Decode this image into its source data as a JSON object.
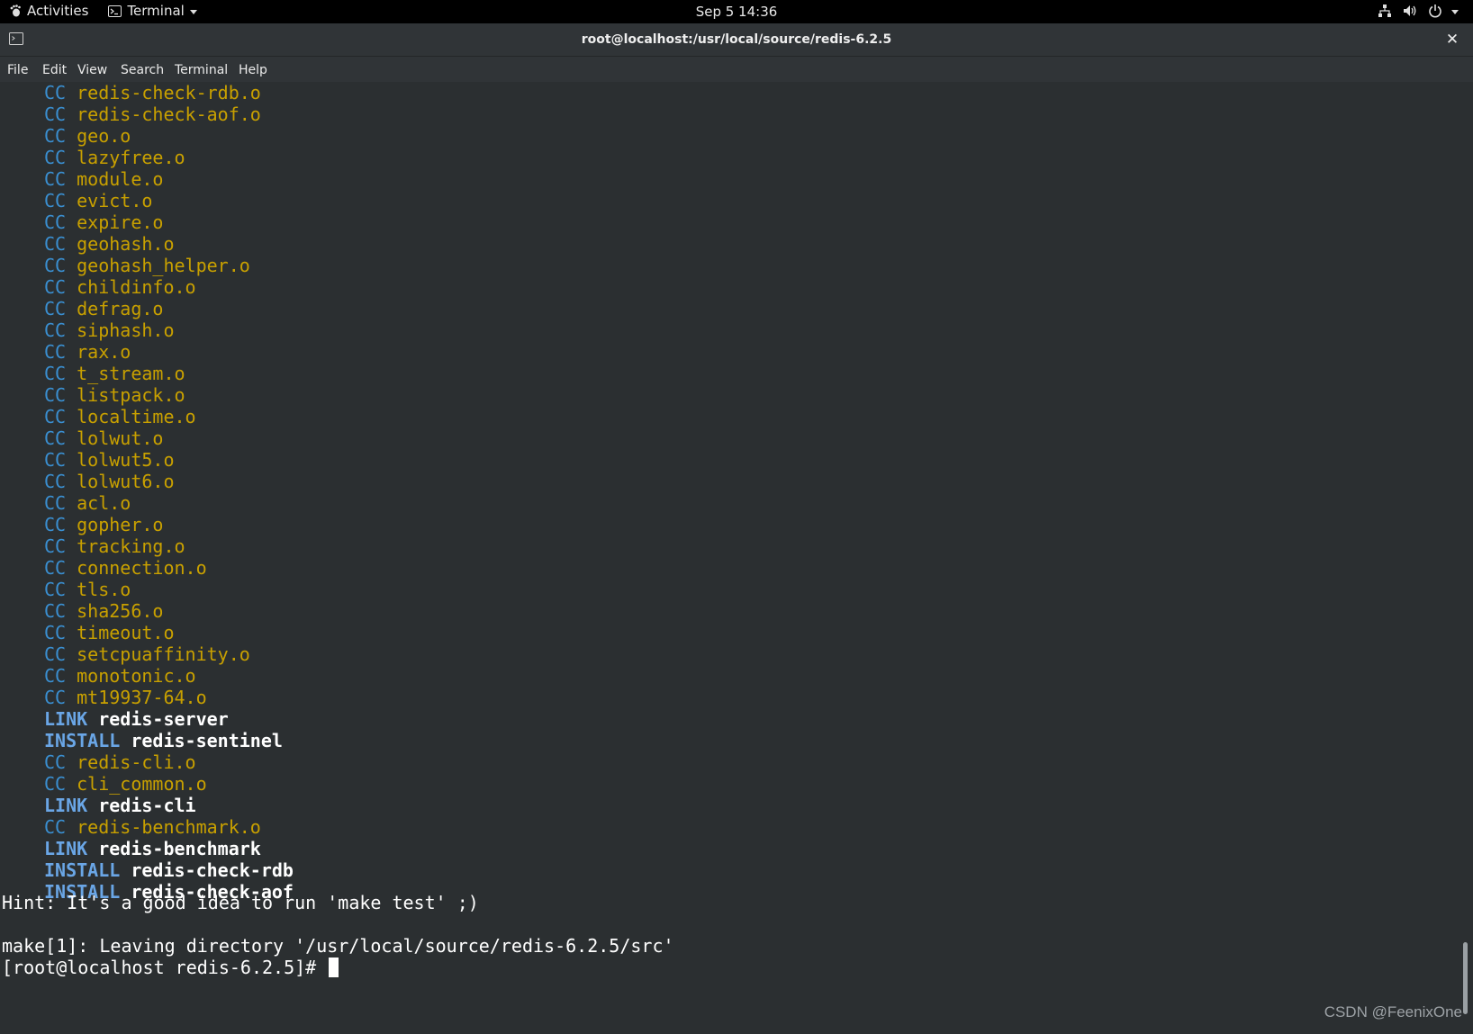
{
  "topbar": {
    "activities": "Activities",
    "app": "Terminal",
    "clock": "Sep 5  14:36"
  },
  "window": {
    "title": "root@localhost:/usr/local/source/redis-6.2.5"
  },
  "menu": [
    "File",
    "Edit",
    "View",
    "Search",
    "Terminal",
    "Help"
  ],
  "terminal": {
    "build_lines": [
      {
        "kind": "CC",
        "target": "redis-check-rdb.o"
      },
      {
        "kind": "CC",
        "target": "redis-check-aof.o"
      },
      {
        "kind": "CC",
        "target": "geo.o"
      },
      {
        "kind": "CC",
        "target": "lazyfree.o"
      },
      {
        "kind": "CC",
        "target": "module.o"
      },
      {
        "kind": "CC",
        "target": "evict.o"
      },
      {
        "kind": "CC",
        "target": "expire.o"
      },
      {
        "kind": "CC",
        "target": "geohash.o"
      },
      {
        "kind": "CC",
        "target": "geohash_helper.o"
      },
      {
        "kind": "CC",
        "target": "childinfo.o"
      },
      {
        "kind": "CC",
        "target": "defrag.o"
      },
      {
        "kind": "CC",
        "target": "siphash.o"
      },
      {
        "kind": "CC",
        "target": "rax.o"
      },
      {
        "kind": "CC",
        "target": "t_stream.o"
      },
      {
        "kind": "CC",
        "target": "listpack.o"
      },
      {
        "kind": "CC",
        "target": "localtime.o"
      },
      {
        "kind": "CC",
        "target": "lolwut.o"
      },
      {
        "kind": "CC",
        "target": "lolwut5.o"
      },
      {
        "kind": "CC",
        "target": "lolwut6.o"
      },
      {
        "kind": "CC",
        "target": "acl.o"
      },
      {
        "kind": "CC",
        "target": "gopher.o"
      },
      {
        "kind": "CC",
        "target": "tracking.o"
      },
      {
        "kind": "CC",
        "target": "connection.o"
      },
      {
        "kind": "CC",
        "target": "tls.o"
      },
      {
        "kind": "CC",
        "target": "sha256.o"
      },
      {
        "kind": "CC",
        "target": "timeout.o"
      },
      {
        "kind": "CC",
        "target": "setcpuaffinity.o"
      },
      {
        "kind": "CC",
        "target": "monotonic.o"
      },
      {
        "kind": "CC",
        "target": "mt19937-64.o"
      },
      {
        "kind": "LINK",
        "target": "redis-server"
      },
      {
        "kind": "INSTALL",
        "target": "redis-sentinel"
      },
      {
        "kind": "CC",
        "target": "redis-cli.o"
      },
      {
        "kind": "CC",
        "target": "cli_common.o"
      },
      {
        "kind": "LINK",
        "target": "redis-cli"
      },
      {
        "kind": "CC",
        "target": "redis-benchmark.o"
      },
      {
        "kind": "LINK",
        "target": "redis-benchmark"
      },
      {
        "kind": "INSTALL",
        "target": "redis-check-rdb"
      },
      {
        "kind": "INSTALL",
        "target": "redis-check-aof"
      }
    ],
    "hint": "Hint: It's a good idea to run 'make test' ;)",
    "leaving": "make[1]: Leaving directory '/usr/local/source/redis-6.2.5/src'",
    "prompt": "[root@localhost redis-6.2.5]# "
  },
  "watermark": "CSDN @FeenixOne",
  "colors": {
    "background": "#2b2f31",
    "cc": "#3a8fd1",
    "object": "#c8a000",
    "keyword": "#6aa6e6"
  }
}
